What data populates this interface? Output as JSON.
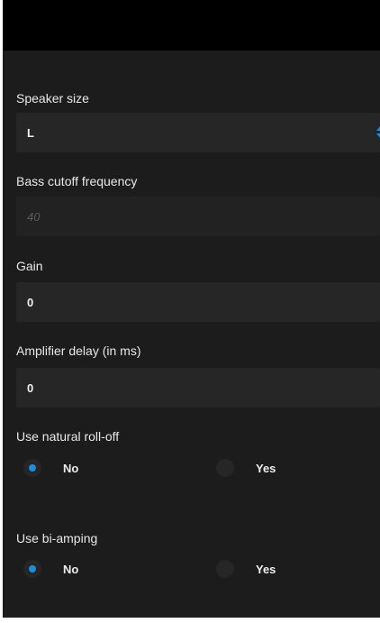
{
  "fields": {
    "speaker_size": {
      "label": "Speaker size",
      "value": "L"
    },
    "bass_cutoff": {
      "label": "Bass cutoff frequency",
      "placeholder": "40"
    },
    "gain": {
      "label": "Gain",
      "value": "0"
    },
    "amplifier_delay": {
      "label": "Amplifier delay (in ms)",
      "value": "0"
    }
  },
  "natural_rolloff": {
    "label": "Use natural roll-off",
    "options": [
      {
        "label": "No",
        "checked": true
      },
      {
        "label": "Yes",
        "checked": false
      }
    ]
  },
  "bi_amping": {
    "label": "Use bi-amping",
    "options": [
      {
        "label": "No",
        "checked": true
      },
      {
        "label": "Yes",
        "checked": false
      }
    ]
  },
  "colors": {
    "accent": "#1a8fe0",
    "background": "#1c1c1c",
    "field_background": "#262626",
    "header": "#000000"
  }
}
